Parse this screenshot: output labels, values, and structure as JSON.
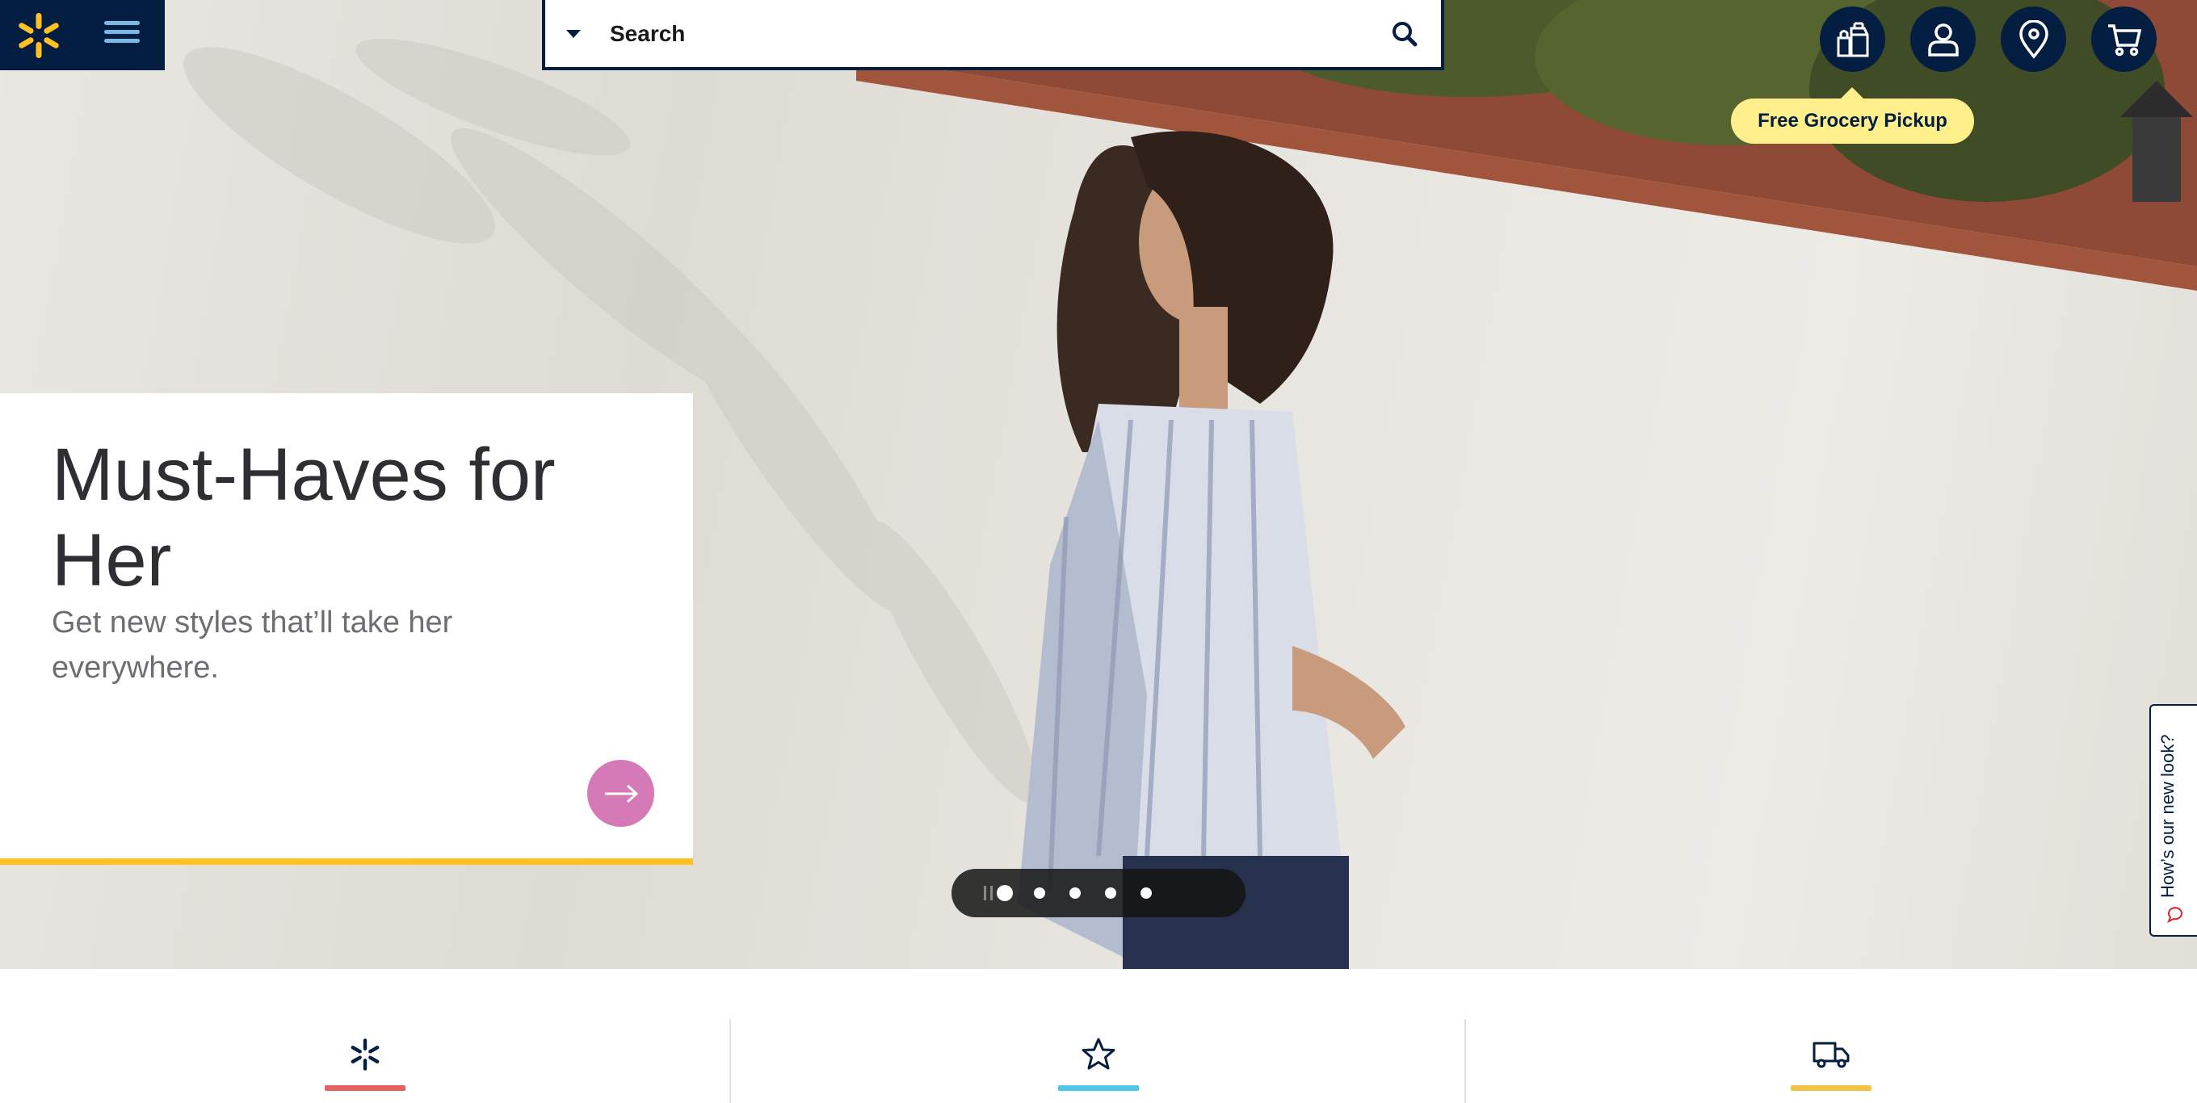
{
  "header": {
    "logo": "walmart-spark-logo",
    "menu_icon": "hamburger-menu-icon",
    "search": {
      "placeholder": "Search",
      "value": ""
    },
    "icons": [
      "grocery-bag-icon",
      "account-icon",
      "store-location-icon",
      "cart-icon"
    ],
    "tooltip": "Free Grocery Pickup"
  },
  "hero": {
    "title": "Must-Haves for Her",
    "subtitle": "Get new styles that’ll take her everywhere.",
    "carousel": {
      "slide_count": 5,
      "active_index": 0
    }
  },
  "feedback": {
    "label": "How’s our new look?"
  },
  "value_props": [
    {
      "icon": "spark-icon",
      "color": "#e5605e"
    },
    {
      "icon": "star-icon",
      "color": "#4ec6e8"
    },
    {
      "icon": "delivery-truck-icon",
      "color": "#f5c343"
    }
  ],
  "colors": {
    "navy": "#041e42",
    "yellow": "#ffc220",
    "tooltip": "#ffef8a",
    "pink": "#d679b7",
    "menu_blue": "#78b9e7"
  }
}
